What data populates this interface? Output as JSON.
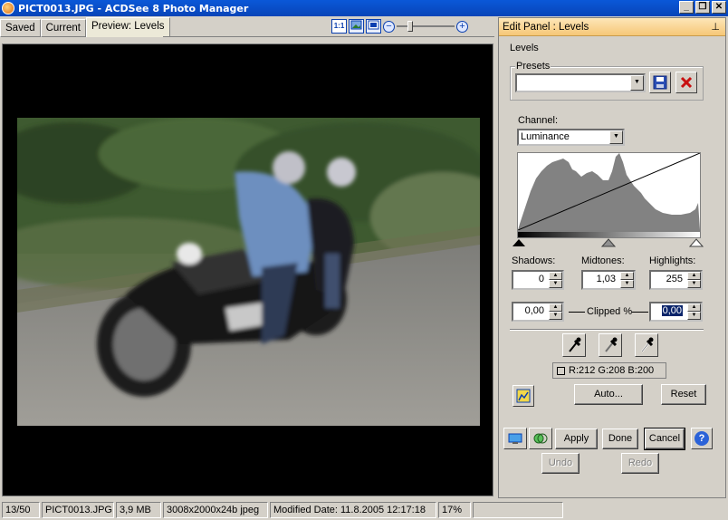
{
  "window": {
    "title": "PICT0013.JPG - ACDSee 8 Photo Manager",
    "buttons": {
      "minimize": "_",
      "maximize": "❐",
      "close": "✕"
    }
  },
  "tabs": [
    {
      "label": "Saved"
    },
    {
      "label": "Current"
    },
    {
      "label": "Preview: Levels",
      "active": true
    }
  ],
  "view_tools": {
    "actual_size": "1:1",
    "zoom_out": "−",
    "zoom_in": "+",
    "zoom_level": 0.2
  },
  "panel": {
    "title": "Edit Panel : Levels",
    "pin": "ᵖ",
    "section": "Levels",
    "presets_label": "Presets",
    "presets_value": "",
    "channel_label": "Channel:",
    "channel_value": "Luminance",
    "shadows_label": "Shadows:",
    "midtones_label": "Midtones:",
    "highlights_label": "Highlights:",
    "shadows_value": "0",
    "midtones_value": "1,03",
    "highlights_value": "255",
    "clip_low": "0,00",
    "clip_high": "0,00",
    "clipped_label": "Clipped %",
    "rgb_readout": "R:212  G:208  B:200",
    "auto_button": "Auto...",
    "reset_button": "Reset",
    "apply_button": "Apply",
    "done_button": "Done",
    "cancel_button": "Cancel",
    "undo_button": "Undo",
    "redo_button": "Redo",
    "help": "?"
  },
  "status": {
    "position": "13/50",
    "filename": "PICT0013.JPG",
    "size": "3,9 MB",
    "dimensions": "3008x2000x24b jpeg",
    "modified": "Modified Date: 11.8.2005 12:17:18",
    "zoom": "17%"
  },
  "colors": {
    "title_bar": "#0a58d8",
    "panel_header": "#f6c777",
    "accent_red": "#c81010"
  }
}
